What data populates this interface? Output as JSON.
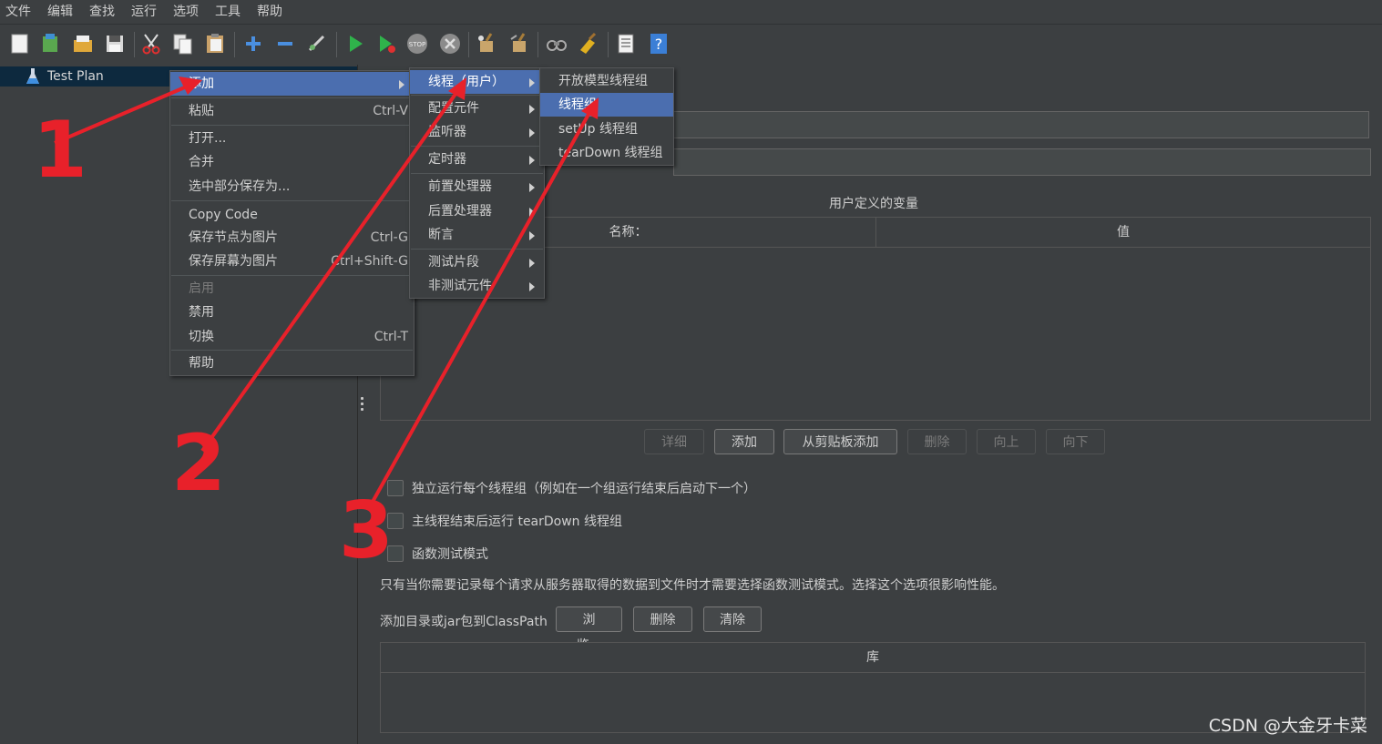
{
  "menubar": [
    "文件",
    "编辑",
    "查找",
    "运行",
    "选项",
    "工具",
    "帮助"
  ],
  "toolbar_icons": [
    "new-icon",
    "templates-icon",
    "open-icon",
    "save-icon",
    "cut-icon",
    "copy-icon",
    "paste-icon",
    "expand-icon",
    "collapse-icon",
    "toggle-icon",
    "start-icon",
    "start-no-pause-icon",
    "stop-icon",
    "shutdown-icon",
    "clear-icon",
    "clear-all-icon",
    "search-icon",
    "reset-search-icon",
    "function-helper-icon",
    "help-icon"
  ],
  "tree": {
    "root_label": "Test Plan"
  },
  "context_menu": {
    "items": [
      {
        "label": "添加",
        "shortcut": "",
        "submenu": true,
        "selected": true,
        "disabled": false
      },
      {
        "label": "粘贴",
        "shortcut": "Ctrl-V"
      },
      {
        "label": "打开...",
        "shortcut": ""
      },
      {
        "label": "合并",
        "shortcut": ""
      },
      {
        "label": "选中部分保存为...",
        "shortcut": ""
      },
      {
        "label": "Copy Code",
        "shortcut": ""
      },
      {
        "label": "保存节点为图片",
        "shortcut": "Ctrl-G"
      },
      {
        "label": "保存屏幕为图片",
        "shortcut": "Ctrl+Shift-G"
      },
      {
        "label": "启用",
        "shortcut": "",
        "disabled": true
      },
      {
        "label": "禁用",
        "shortcut": ""
      },
      {
        "label": "切换",
        "shortcut": "Ctrl-T"
      },
      {
        "label": "帮助",
        "shortcut": ""
      }
    ]
  },
  "add_submenu": {
    "items": [
      {
        "label": "线程（用户）",
        "selected": true
      },
      {
        "label": "配置元件"
      },
      {
        "label": "监听器"
      },
      {
        "label": "定时器"
      },
      {
        "label": "前置处理器"
      },
      {
        "label": "后置处理器"
      },
      {
        "label": "断言"
      },
      {
        "label": "测试片段"
      },
      {
        "label": "非测试元件"
      }
    ]
  },
  "threads_submenu": {
    "items": [
      {
        "label": "开放模型线程组"
      },
      {
        "label": "线程组",
        "selected": true
      },
      {
        "label": "setUp 线程组"
      },
      {
        "label": "tearDown 线程组"
      }
    ]
  },
  "test_plan_panel": {
    "user_vars_title": "用户定义的变量",
    "columns": [
      "名称：",
      "值"
    ],
    "buttons": [
      {
        "label": "详细",
        "disabled": true
      },
      {
        "label": "添加",
        "disabled": false
      },
      {
        "label": "从剪贴板添加",
        "disabled": false
      },
      {
        "label": "删除",
        "disabled": true
      },
      {
        "label": "向上",
        "disabled": true
      },
      {
        "label": "向下",
        "disabled": true
      }
    ],
    "checkboxes": [
      {
        "label": "独立运行每个线程组（例如在一个组运行结束后启动下一个）",
        "checked": false
      },
      {
        "label": "主线程结束后运行 tearDown 线程组",
        "checked": false
      },
      {
        "label": "函数测试模式",
        "checked": false
      }
    ],
    "functional_note": "只有当你需要记录每个请求从服务器取得的数据到文件时才需要选择函数测试模式。选择这个选项很影响性能。",
    "classpath_label": "添加目录或jar包到ClassPath",
    "classpath_buttons": [
      "浏览...",
      "删除",
      "清除"
    ],
    "library_column": "库"
  },
  "annotations": {
    "step1": "1",
    "step2": "2",
    "step3": "3",
    "arrow_color": "#e8212a"
  },
  "watermark": "CSDN @大金牙卡菜"
}
